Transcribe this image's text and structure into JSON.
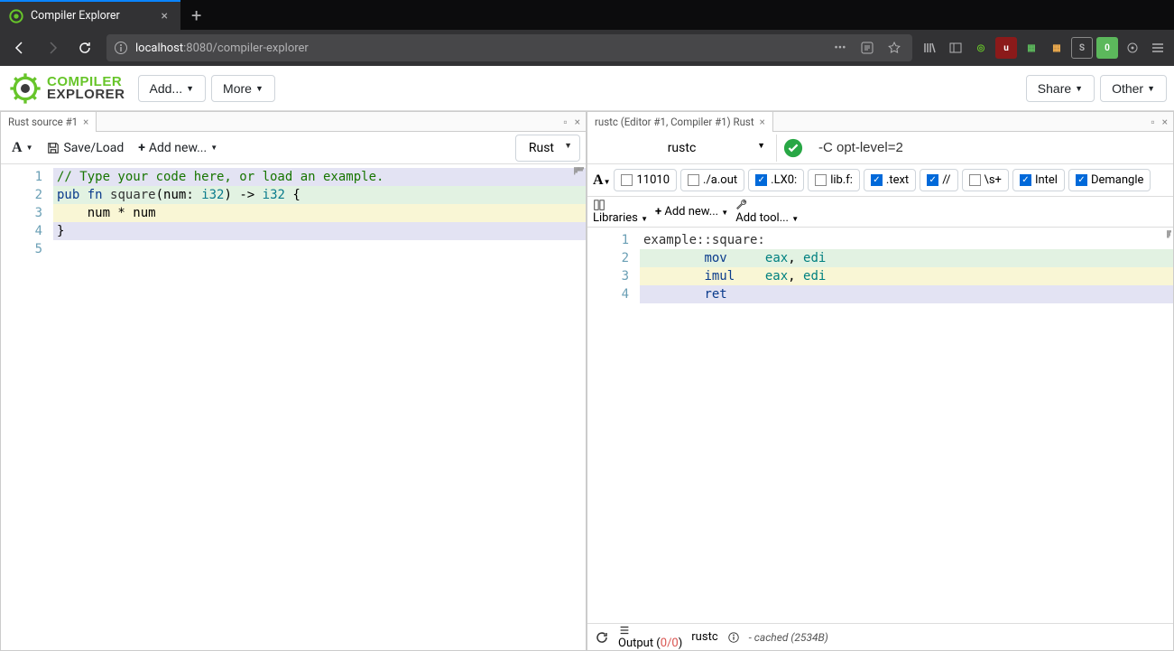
{
  "browser": {
    "tab_title": "Compiler Explorer",
    "url_host": "localhost",
    "url_port_path": ":8080/compiler-explorer"
  },
  "header": {
    "logo_line1": "COMPILER",
    "logo_line2": "EXPLORER",
    "btn_add": "Add...",
    "btn_more": "More",
    "btn_share": "Share",
    "btn_other": "Other"
  },
  "left_pane": {
    "tab_title": "Rust source #1",
    "tool_save": "Save/Load",
    "tool_addnew": "Add new...",
    "language": "Rust",
    "gutter": [
      "1",
      "2",
      "3",
      "4",
      "5"
    ],
    "code": {
      "l1_comment": "// Type your code here, or load an example.",
      "l2_kw1": "pub",
      "l2_kw2": "fn",
      "l2_fn": "square",
      "l2_sig1": "(num: ",
      "l2_type1": "i32",
      "l2_sig2": ") -> ",
      "l2_type2": "i32",
      "l2_sig3": " {",
      "l3_body": "    num * num",
      "l4_close": "}"
    }
  },
  "right_pane": {
    "tab_title": "rustc (Editor #1, Compiler #1) Rust",
    "compiler": "rustc",
    "options": "-C opt-level=2",
    "filters": {
      "f1": "11010",
      "f2": "./a.out",
      "f3": ".LX0:",
      "f4": "lib.f:",
      "f5": ".text",
      "f6": "//",
      "f7": "\\s+",
      "f8": "Intel",
      "f9": "Demangle"
    },
    "lib_label": "Libraries",
    "addnew_label": "Add new...",
    "addtool_label": "Add tool...",
    "gutter": [
      "1",
      "2",
      "3",
      "4"
    ],
    "asm": {
      "l1": "example::square:",
      "l2_op": "mov",
      "l2_args_a": "eax",
      "l2_args_b": "edi",
      "l3_op": "imul",
      "l3_args_a": "eax",
      "l3_args_b": "edi",
      "l4_op": "ret"
    },
    "footer": {
      "output_label": "Output (",
      "output_zeros": "0/0",
      "output_close": ")",
      "compiler": "rustc",
      "cached": "- cached (2534B)"
    }
  }
}
